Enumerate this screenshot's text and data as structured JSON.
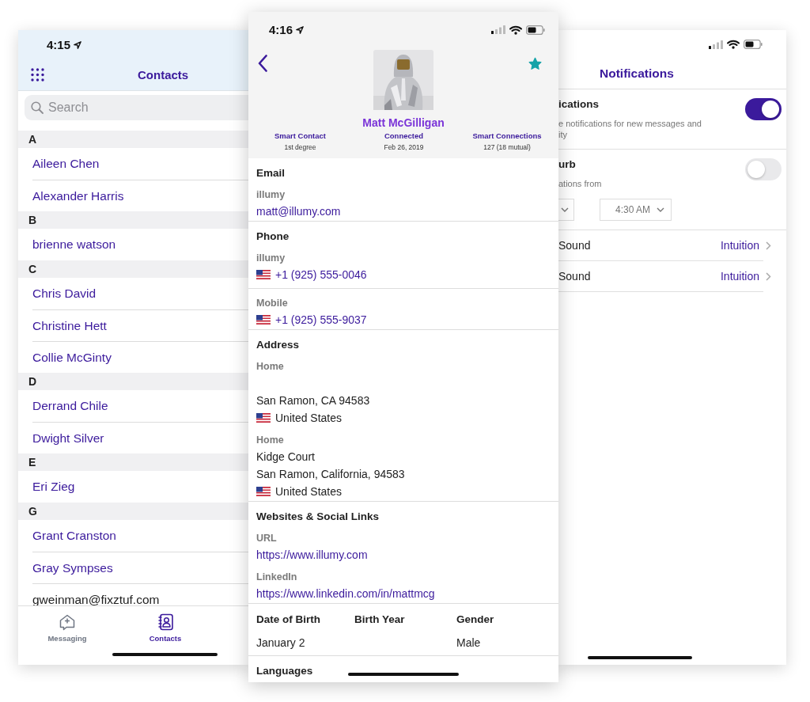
{
  "contacts_screen": {
    "status_time": "4:15",
    "title": "Contacts",
    "search": {
      "placeholder": "Search"
    },
    "sections": [
      {
        "letter": "A",
        "contacts": [
          {
            "name": "Aileen Chen",
            "kind": "name"
          },
          {
            "name": "Alexander Harris",
            "kind": "name"
          }
        ]
      },
      {
        "letter": "B",
        "contacts": [
          {
            "name": "brienne watson",
            "kind": "name"
          }
        ]
      },
      {
        "letter": "C",
        "contacts": [
          {
            "name": "Chris David",
            "kind": "name"
          },
          {
            "name": "Christine Hett",
            "kind": "name"
          },
          {
            "name": "Collie McGinty",
            "kind": "name"
          }
        ]
      },
      {
        "letter": "D",
        "contacts": [
          {
            "name": "Derrand Chile",
            "kind": "name"
          },
          {
            "name": "Dwight Silver",
            "kind": "name"
          }
        ]
      },
      {
        "letter": "E",
        "contacts": [
          {
            "name": "Eri Zieg",
            "kind": "name"
          }
        ]
      },
      {
        "letter": "G",
        "contacts": [
          {
            "name": "Grant Cranston",
            "kind": "name"
          },
          {
            "name": "Gray Sympses",
            "kind": "name"
          },
          {
            "name": "gweinman@fixztuf.com",
            "kind": "email"
          }
        ]
      }
    ],
    "tabs": [
      {
        "label": "Messaging",
        "kind": "messaging",
        "selected": false
      },
      {
        "label": "Contacts",
        "kind": "contacts",
        "selected": true
      }
    ]
  },
  "profile_screen": {
    "status_time": "4:16",
    "favorite": true,
    "name": "Matt McGilligan",
    "stats": [
      {
        "label": "Smart Contact",
        "value": "1st degree"
      },
      {
        "label": "Connected",
        "value": "Feb 26, 2019"
      },
      {
        "label": "Smart Connections",
        "value": "127 (18 mutual)"
      }
    ],
    "sections": [
      {
        "title": "Email",
        "kind": "email",
        "entries": [
          {
            "label": "illumy",
            "value": "matt@illumy.com"
          }
        ]
      },
      {
        "title": "Phone",
        "kind": "phone",
        "entries": [
          {
            "label": "illumy",
            "value": "+1 (925) 555-0046"
          },
          {
            "label": "Mobile",
            "value": "+1 (925) 555-9037"
          }
        ]
      },
      {
        "title": "Address",
        "kind": "address",
        "entries": [
          {
            "label": "Home",
            "city": "San Ramon, CA 94583",
            "country": "United States"
          },
          {
            "label": "Home",
            "street": "Kidge Court",
            "city": "San Ramon, California, 94583",
            "country": "United States"
          }
        ]
      },
      {
        "title": "Websites & Social Links",
        "kind": "link",
        "entries": [
          {
            "label": "URL",
            "value": "https://www.illumy.com"
          },
          {
            "label": "LinkedIn",
            "value": "https://www.linkedin.com/in/mattmcg"
          }
        ]
      },
      {
        "kind": "details",
        "fields": [
          {
            "label": "Date of Birth",
            "value": "January 2"
          },
          {
            "label": "Birth Year"
          },
          {
            "label": "Gender",
            "value": "Male"
          }
        ]
      },
      {
        "title": "Languages",
        "kind": "heading"
      }
    ]
  },
  "notifications_screen": {
    "title": "Notifications",
    "settings": [
      {
        "kind": "toggle",
        "label": "ications",
        "on": true,
        "description": [
          "e notifications for new messages and",
          "ity"
        ]
      },
      {
        "kind": "toggle",
        "label": "urb",
        "on": false,
        "description": [
          "ations from"
        ],
        "time_pickers": [
          {
            "cut_off": true
          },
          {
            "value": "4:30 AM"
          }
        ]
      },
      {
        "kind": "link",
        "label": "Sound",
        "value": "Intuition"
      },
      {
        "kind": "link",
        "label": "Sound",
        "value": "Intuition"
      }
    ]
  }
}
